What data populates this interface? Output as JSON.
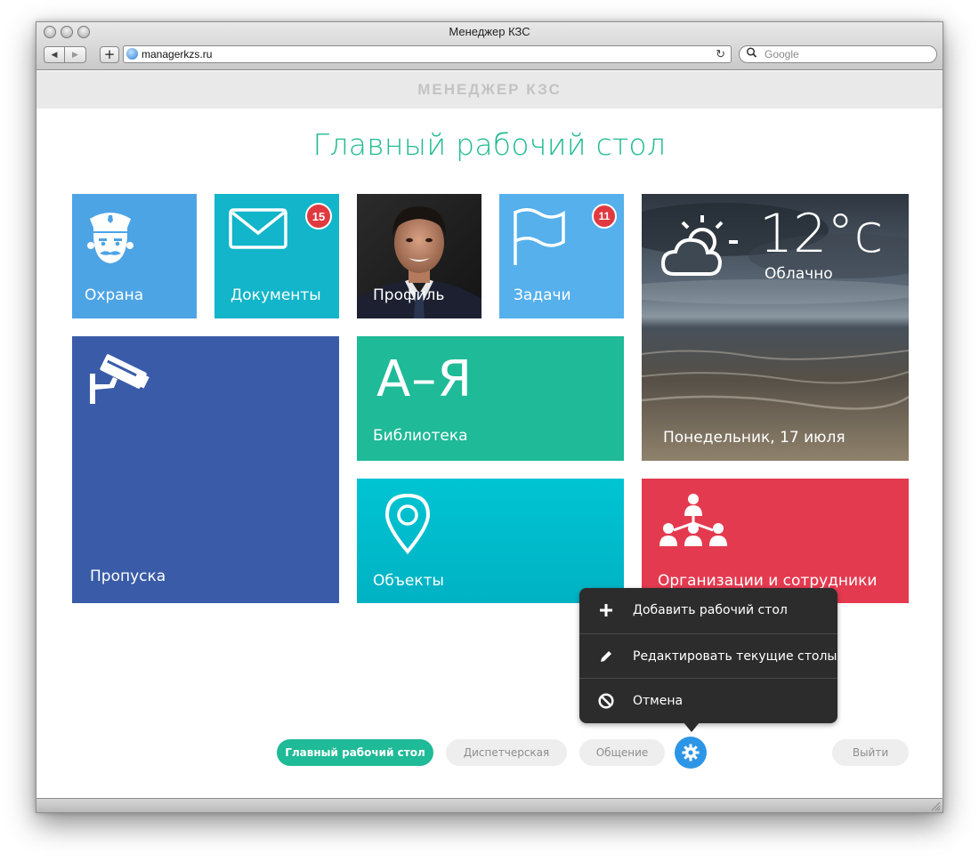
{
  "browser": {
    "window_title": "Менеджер КЗС",
    "url": "managerkzs.ru",
    "search_placeholder": "Google",
    "back_icon": "◀",
    "forward_icon": "▶",
    "add_tab_icon": "+",
    "reload_icon": "↻"
  },
  "app": {
    "header_title": "МЕНЕДЖЕР КЗС",
    "page_title": "Главный рабочий стол"
  },
  "tiles": {
    "guard": {
      "label": "Охрана",
      "icon": "police-officer-icon",
      "color": "#4da4e5"
    },
    "docs": {
      "label": "Документы",
      "badge": "15",
      "icon": "envelope-icon",
      "color": "#12b5c9"
    },
    "profile": {
      "label": "Профиль",
      "icon": "profile-photo"
    },
    "tasks": {
      "label": "Задачи",
      "badge": "11",
      "icon": "flag-icon",
      "color": "#55b0ec"
    },
    "weather": {
      "temperature": "12°c",
      "condition": "Облачно",
      "date": "Понедельник, 17 июля",
      "icon": "partly-cloudy-icon"
    },
    "passes": {
      "label": "Пропуска",
      "icon": "security-camera-icon",
      "color": "#3a5ca8"
    },
    "library": {
      "label": "Библиотека",
      "glyph": "А–Я",
      "color": "#1fba97"
    },
    "objects": {
      "label": "Объекты",
      "icon": "map-pin-icon",
      "color": "#00bccb"
    },
    "orgs": {
      "label": "Организации и сотрудники",
      "icon": "org-structure-icon",
      "color": "#e43a4f"
    }
  },
  "menu": {
    "items": [
      {
        "label": "Добавить рабочий стол",
        "icon": "plus-icon"
      },
      {
        "label": "Редактировать текущие столы",
        "icon": "pencil-icon"
      },
      {
        "label": "Отмена",
        "icon": "cancel-icon"
      }
    ]
  },
  "bottom_nav": {
    "main": "Главный рабочий стол",
    "dispatch": "Диспетчерская",
    "chat": "Общение",
    "settings_icon": "gear-icon",
    "exit": "Выйти"
  },
  "colors": {
    "accent": "#1fba97",
    "badge": "#e0393f",
    "settings": "#2d95e6"
  }
}
